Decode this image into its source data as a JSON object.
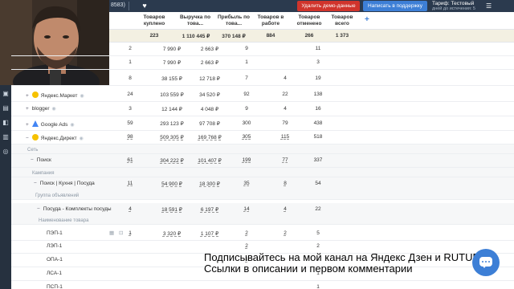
{
  "topbar": {
    "number": "8583)",
    "demo_button": "Удалить демо-данные",
    "support_button": "Написать в поддержку",
    "tariff_label": "Тариф: Тестовый",
    "tariff_sub": "дней до истечения: 5"
  },
  "columns": [
    "Товаров куплено",
    "Выручка по това...",
    "Прибыль по това...",
    "Товаров в работе",
    "Товаров отменено",
    "Товаров всего"
  ],
  "totals": [
    "223",
    "1 110 445 ₽",
    "370 148 ₽",
    "884",
    "266",
    "1 373"
  ],
  "rows": [
    {
      "label": "",
      "values": [
        "2",
        "7 990 ₽",
        "2 663 ₽",
        "9",
        "",
        "11"
      ]
    },
    {
      "label": "",
      "values": [
        "1",
        "7 990 ₽",
        "2 663 ₽",
        "1",
        "",
        "3"
      ]
    },
    {
      "label": "",
      "values": [
        "8",
        "38 155 ₽",
        "12 718 ₽",
        "7",
        "4",
        "19"
      ]
    },
    {
      "label": "Яндекс.Маркет",
      "values": [
        "24",
        "103 559 ₽",
        "34 520 ₽",
        "92",
        "22",
        "138"
      ]
    },
    {
      "label": "blogger",
      "values": [
        "3",
        "12 144 ₽",
        "4 048 ₽",
        "9",
        "4",
        "16"
      ]
    },
    {
      "label": "Google Ads",
      "values": [
        "59",
        "293 123 ₽",
        "97 708 ₽",
        "300",
        "79",
        "438"
      ]
    },
    {
      "label": "Яндекс.Директ",
      "values": [
        "98",
        "509 305 ₽",
        "169 768 ₽",
        "305",
        "115",
        "518"
      ]
    },
    {
      "label": "Сеть",
      "values": [
        "",
        "",
        "",
        "",
        "",
        ""
      ]
    },
    {
      "label": "Поиск",
      "values": [
        "61",
        "304 222 ₽",
        "101 407 ₽",
        "199",
        "77",
        "337"
      ]
    },
    {
      "label": "Кампания",
      "values": [
        "",
        "",
        "",
        "",
        "",
        ""
      ]
    },
    {
      "label": "Поиск | Кухня | Посуда",
      "values": [
        "11",
        "54 900 ₽",
        "18 300 ₽",
        "35",
        "8",
        "54"
      ]
    },
    {
      "label": "Группа объявлений",
      "values": [
        "",
        "",
        "",
        "",
        "",
        ""
      ]
    },
    {
      "label": "Посуда - Комплекты посуды",
      "values": [
        "4",
        "18 591 ₽",
        "6 197 ₽",
        "14",
        "4",
        "22"
      ]
    },
    {
      "label": "Наименование товара",
      "values": [
        "",
        "",
        "",
        "",
        "",
        ""
      ]
    },
    {
      "label": "ПЭП-1",
      "values": [
        "1",
        "3 320 ₽",
        "1 107 ₽",
        "2",
        "2",
        "5"
      ]
    },
    {
      "label": "ЛЭП-1",
      "values": [
        "",
        "",
        "",
        "2",
        "",
        "2"
      ]
    },
    {
      "label": "ОПА-1",
      "values": [
        "",
        "",
        "",
        "4",
        "",
        "4"
      ]
    },
    {
      "label": "ЛСА-1",
      "values": [
        "",
        "",
        "",
        "",
        "",
        "1"
      ]
    },
    {
      "label": "ПСП-1",
      "values": [
        "",
        "",
        "",
        "",
        "",
        "1"
      ]
    }
  ],
  "banner": {
    "line1": "Подписывайтесь на мой канал на Яндекс Дзен и RUTUBE",
    "line2": "Ссылки в описании и первом комментарии"
  },
  "icons": {
    "heart": "heart-icon",
    "chat": "chat-icon",
    "menu": "menu-icon"
  },
  "colors": {
    "topbar": "#2b3a4e",
    "demo": "#d0342c",
    "support": "#3d7fd6",
    "totals_bg": "#f3f0e2"
  }
}
